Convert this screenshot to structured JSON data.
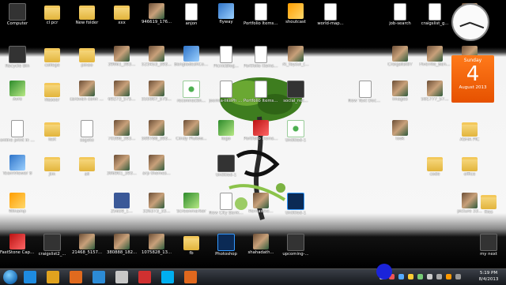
{
  "desktop": {
    "icons": [
      {
        "label": "Computer",
        "kind": "dark"
      },
      {
        "label": "cl pcr",
        "kind": "folder"
      },
      {
        "label": "New folder",
        "kind": "folder"
      },
      {
        "label": "xxx",
        "kind": "folder"
      },
      {
        "label": "946619_176...",
        "kind": "photo"
      },
      {
        "label": "anjon",
        "kind": "doc"
      },
      {
        "label": "flyway",
        "kind": "app"
      },
      {
        "label": "Portfolio Items-1995...",
        "kind": "doc"
      },
      {
        "label": "shoutcast",
        "kind": "orange"
      },
      {
        "label": "world-map...",
        "kind": "doc"
      },
      {
        "label": "job-search",
        "kind": "doc"
      },
      {
        "label": "craigslist_g...",
        "kind": "doc"
      },
      {
        "label": "timthumb",
        "kind": "photo"
      },
      {
        "label": "Recycle Bin",
        "kind": "dark"
      },
      {
        "label": "college",
        "kind": "folder"
      },
      {
        "label": "pinoo",
        "kind": "folder"
      },
      {
        "label": "39061_393...",
        "kind": "photo"
      },
      {
        "label": "523453_393...",
        "kind": "photo"
      },
      {
        "label": "BangladeshCommercial...",
        "kind": "app"
      },
      {
        "label": "PicnicBlog...",
        "kind": "doc"
      },
      {
        "label": "Portfolio Items-1995...",
        "kind": "doc"
      },
      {
        "label": "rk_fayzul_(...",
        "kind": "photo"
      },
      {
        "label": "Craigslist07",
        "kind": "photo"
      },
      {
        "label": "Fiverrlie_Ban...",
        "kind": "photo"
      },
      {
        "label": "Blog graphic...",
        "kind": "photo"
      },
      {
        "label": "Avro",
        "kind": "green"
      },
      {
        "label": "Naseer",
        "kind": "folder"
      },
      {
        "label": "caravan conn photo for f...",
        "kind": "photo"
      },
      {
        "label": "69273_575...",
        "kind": "photo"
      },
      {
        "label": "555007_575...",
        "kind": "photo"
      },
      {
        "label": "reconnectin...",
        "kind": "wifi"
      },
      {
        "label": "joomla-likePh newsroo...",
        "kind": "doc"
      },
      {
        "label": "Portfolio Items-1995...",
        "kind": "doc"
      },
      {
        "label": "social_net...",
        "kind": "dark"
      },
      {
        "label": "New Text Document",
        "kind": "doc"
      },
      {
        "label": "images",
        "kind": "photo"
      },
      {
        "label": "581777_57...",
        "kind": "photo"
      },
      {
        "label": "online print in ux",
        "kind": "doc"
      },
      {
        "label": "last",
        "kind": "folder"
      },
      {
        "label": "ssgeto",
        "kind": "doc"
      },
      {
        "label": "70398_393...",
        "kind": "photo"
      },
      {
        "label": "509788_393...",
        "kind": "photo"
      },
      {
        "label": "Cindy Plutow...",
        "kind": "photo"
      },
      {
        "label": "logo",
        "kind": "green"
      },
      {
        "label": "Portfolio Items-1995...",
        "kind": "red"
      },
      {
        "label": "Untitled-1",
        "kind": "wifi"
      },
      {
        "label": "look",
        "kind": "photo"
      },
      {
        "label": "ASHA PIC",
        "kind": "folder"
      },
      {
        "label": "TeamViewer 8",
        "kind": "app"
      },
      {
        "label": "Jim",
        "kind": "folder"
      },
      {
        "label": "all",
        "kind": "folder"
      },
      {
        "label": "306901_393...",
        "kind": "photo"
      },
      {
        "label": "arp themes...",
        "kind": "photo"
      },
      {
        "label": "Untitled-1",
        "kind": "dark"
      },
      {
        "label": "code",
        "kind": "folder"
      },
      {
        "label": "office",
        "kind": "folder"
      },
      {
        "label": "Winamp",
        "kind": "orange"
      },
      {
        "label": "25659_1...",
        "kind": "fb"
      },
      {
        "label": "326373_33...",
        "kind": "photo"
      },
      {
        "label": "Screenmarker",
        "kind": "green"
      },
      {
        "label": "New City Bank Ret 88",
        "kind": "doc"
      },
      {
        "label": "Remastke...",
        "kind": "photo"
      },
      {
        "label": "Untitled-1",
        "kind": "ps"
      },
      {
        "label": "picture 33...",
        "kind": "photo"
      },
      {
        "label": "files",
        "kind": "folder"
      },
      {
        "label": "FastStone Capture",
        "kind": "red"
      },
      {
        "label": "craigslist2_...",
        "kind": "dark"
      },
      {
        "label": "21468_5157...",
        "kind": "photo"
      },
      {
        "label": "380888_182...",
        "kind": "photo"
      },
      {
        "label": "1075828_13...",
        "kind": "photo"
      },
      {
        "label": "fb",
        "kind": "folder"
      },
      {
        "label": "Photoshop",
        "kind": "ps"
      },
      {
        "label": "shahadath...",
        "kind": "photo"
      },
      {
        "label": "upcoming-...",
        "kind": "dark"
      },
      {
        "label": "my next",
        "kind": "dark"
      }
    ]
  },
  "calendar": {
    "weekday": "Sunday",
    "day": "4",
    "month_year": "August 2013"
  },
  "taskbar": {
    "pinned": [
      {
        "name": "ie-icon",
        "color": "#1e8be0"
      },
      {
        "name": "chrome-icon",
        "color": "#e0a21e"
      },
      {
        "name": "firefox-icon",
        "color": "#e06a1e"
      },
      {
        "name": "media-player-icon",
        "color": "#2c8bd6"
      },
      {
        "name": "paint-icon",
        "color": "#c7c7c7"
      },
      {
        "name": "tools-icon",
        "color": "#d03030"
      },
      {
        "name": "skype-icon",
        "color": "#00aff0"
      },
      {
        "name": "firefox2-icon",
        "color": "#e0681e"
      }
    ],
    "time": "5:19 PM",
    "date": "8/4/2013"
  }
}
